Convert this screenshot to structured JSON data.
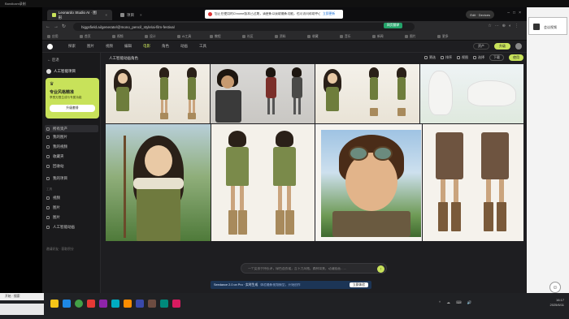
{
  "desktop": {
    "top_label": "Bandicam录制"
  },
  "side_window": {
    "title": "会议视频"
  },
  "browser": {
    "tabs": [
      {
        "label": "Leonardo Studio AI · 图形",
        "active": true
      },
      {
        "label": "项目",
        "active": false
      }
    ],
    "notification": {
      "text": "您正在使用的Chrome版本已过期，请更新以获取最新功能，也可访问帮助中心了解更多",
      "link": "立即更新"
    },
    "tab_right_label": "Edit · Devices",
    "url": "higgsfield.ai/generate/@mono_pencil_style/ai-film-festival",
    "translate_label": "网页翻译",
    "bookmarks": [
      "应用",
      "首页",
      "视频",
      "设计",
      "AI工具",
      "教程",
      "社区",
      "资料",
      "收藏",
      "音乐",
      "新闻",
      "图片",
      "更多"
    ]
  },
  "app": {
    "top_menu": [
      "探索",
      "图片",
      "视频",
      "编辑",
      "电影",
      "角色",
      "动画",
      "工具"
    ],
    "top_menu_highlight_index": 4,
    "header_right": {
      "assets": "资产",
      "upgrade": "升级"
    },
    "sidebar": {
      "back": "← 后退",
      "project": "人工智能项目",
      "promo": {
        "title": "专业风格精准",
        "subtitle": "享受无限生成与专属功能",
        "button": "升级套餐"
      },
      "items": [
        "所有资产",
        "我的图片",
        "我的视频",
        "收藏夹",
        "回收站",
        "我的项目"
      ],
      "section": "工具",
      "tools": [
        "视频",
        "图片",
        "图片",
        "人工智能动画"
      ],
      "footer": "邀请好友 · 获取积分"
    },
    "content": {
      "title": "人工智能动画角色",
      "tools": {
        "filter": "筛选",
        "sort": "排序",
        "view": "视图",
        "select": "选择",
        "download": "下载",
        "use": "使用"
      },
      "tile_caption": "角色设计"
    },
    "prompt": {
      "placeholder": "一个女孩手持长矛，绿色连衣裙，吉卜力风格，森林背景，动漫插画……",
      "send_icon": "arrow-up-icon"
    },
    "banner": {
      "text": "Seedance 2.0 on Pro · 实时生成",
      "dim_text": "体验最新视频模型，开始创作",
      "button": "立即体验"
    }
  },
  "taskbar": {
    "left_label": "开始 · 搜索",
    "time": "16:17",
    "date": "2025/6/11",
    "icons_colors": [
      "#f5c518",
      "#1e88e5",
      "#43a047",
      "#e53935",
      "#8e24aa",
      "#00acc1",
      "#fb8c00",
      "#3949ab",
      "#6d4c41",
      "#00897b",
      "#d81b60"
    ]
  },
  "colors": {
    "accent": "#c8e25a",
    "bg": "#1e1e21",
    "banner": "#1c3556"
  }
}
